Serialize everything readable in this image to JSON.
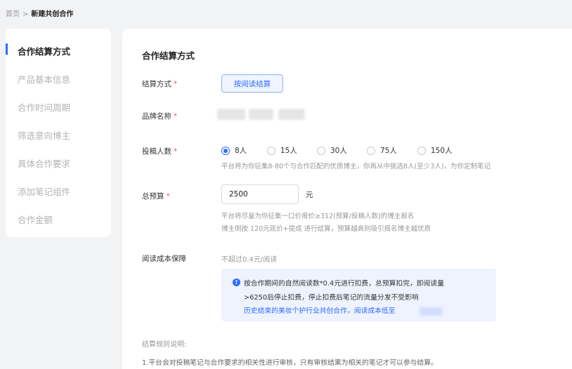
{
  "breadcrumb": {
    "home": "首页",
    "separator": ">",
    "current": "新建共创合作"
  },
  "sidebar": {
    "items": [
      {
        "label": "合作结算方式",
        "active": true
      },
      {
        "label": "产品基本信息",
        "active": false
      },
      {
        "label": "合作时间周期",
        "active": false
      },
      {
        "label": "筛选意向博主",
        "active": false
      },
      {
        "label": "具体合作要求",
        "active": false
      },
      {
        "label": "添加笔记组件",
        "active": false
      },
      {
        "label": "合作金额",
        "active": false
      }
    ],
    "accent_color": "#2f6bff"
  },
  "main": {
    "section_title": "合作结算方式",
    "required_mark": "*",
    "settlement": {
      "label": "结算方式",
      "button_label": "按阅读结算"
    },
    "brand": {
      "label": "品牌名称"
    },
    "submitters": {
      "label": "投稿人数",
      "options": [
        "8人",
        "15人",
        "30人",
        "75人",
        "150人"
      ],
      "selected": "8人",
      "hint": "平台将为你征集8-80个与合作匹配的优质博主，你再从中挑选8人(至少3人)，为你定制笔记"
    },
    "budget": {
      "label": "总预算",
      "value": "2500",
      "unit": "元",
      "hint_line1": "平台将尽量为你征集一口价报价≥312(预算/投稿人数)的博主报名",
      "hint_line2": "博主倒按 120元底价+提成 进行结算，预算越高则吸引报名博主越优质"
    },
    "read_cost": {
      "label": "阅读成本保障",
      "value": "不超过0.4元/阅读",
      "notice": {
        "icon": "info-icon",
        "line1": "按合作期间的自然阅读数*0.4元进行扣费，总预算扣完，即阅读量",
        "line2": ">6250后停止扣费，停止扣费后笔记的流量分发不受影响",
        "line3": "历史结束的美妆个护行业共创合作，阅读成本低至"
      }
    },
    "rules": {
      "title": "结算规则说明:",
      "line1": "1.平台会对投稿笔记与合作要求的相关性进行审核，只有审核结果为相关的笔记才可以参与结算。"
    }
  }
}
